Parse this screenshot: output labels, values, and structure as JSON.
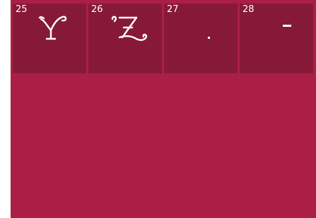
{
  "stitch_tiles": [
    {
      "number": "25",
      "glyph_icon": "ornate-letter-y-icon"
    },
    {
      "number": "26",
      "glyph_icon": "ornate-letter-z-icon"
    },
    {
      "number": "27",
      "glyph_icon": "period-icon"
    },
    {
      "number": "28",
      "glyph_icon": "dash-icon"
    }
  ],
  "colors": {
    "background": "#ab1f47",
    "tile": "#871938",
    "glyph": "#ffffff"
  }
}
